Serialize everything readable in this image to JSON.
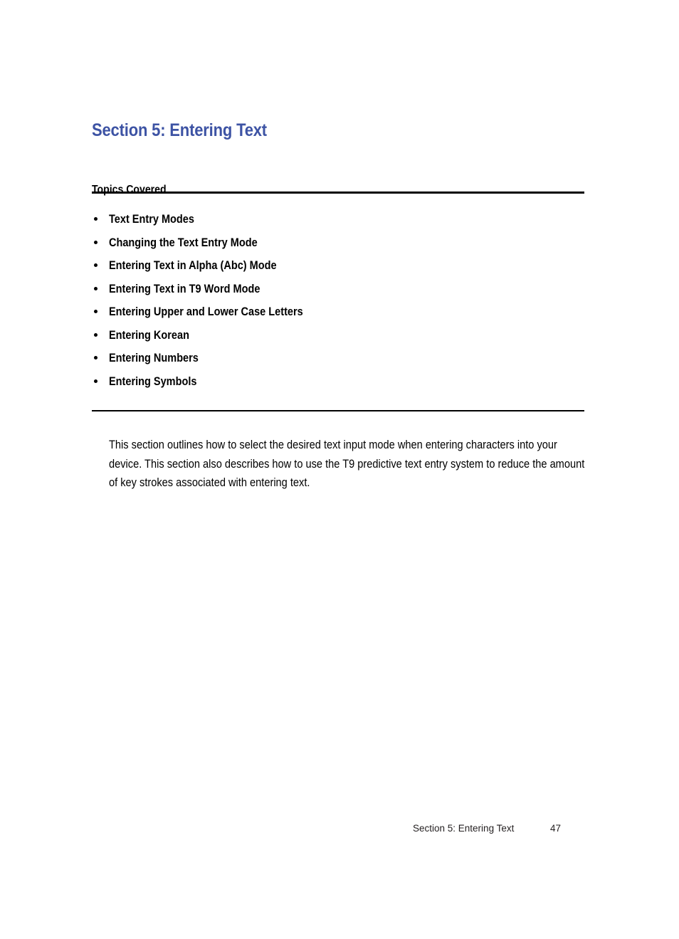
{
  "document": {
    "section_title": "Section 5: Entering Text",
    "topics_heading": "Topics Covered",
    "topics": [
      {
        "label": "Text Entry Modes"
      },
      {
        "label": "Changing the Text Entry Mode"
      },
      {
        "label": "Entering Text in Alpha (Abc) Mode"
      },
      {
        "label": "Entering Text in T9 Word Mode"
      },
      {
        "label": "Entering Upper and Lower Case Letters"
      },
      {
        "label": "Entering Korean"
      },
      {
        "label": "Entering Numbers"
      },
      {
        "label": "Entering Symbols"
      }
    ],
    "intro_paragraph": "This section outlines how to select the desired text input mode when entering characters into your device. This section also describes how to use the T9 predictive text entry system to reduce the amount of key strokes associated with entering text.",
    "footer": {
      "label": "Section 5: Entering Text",
      "page_number": "47"
    },
    "colors": {
      "title": "#3d53a4",
      "text": "#000000",
      "rule": "#000000",
      "footer_text": "#231f20",
      "background": "#ffffff"
    }
  }
}
